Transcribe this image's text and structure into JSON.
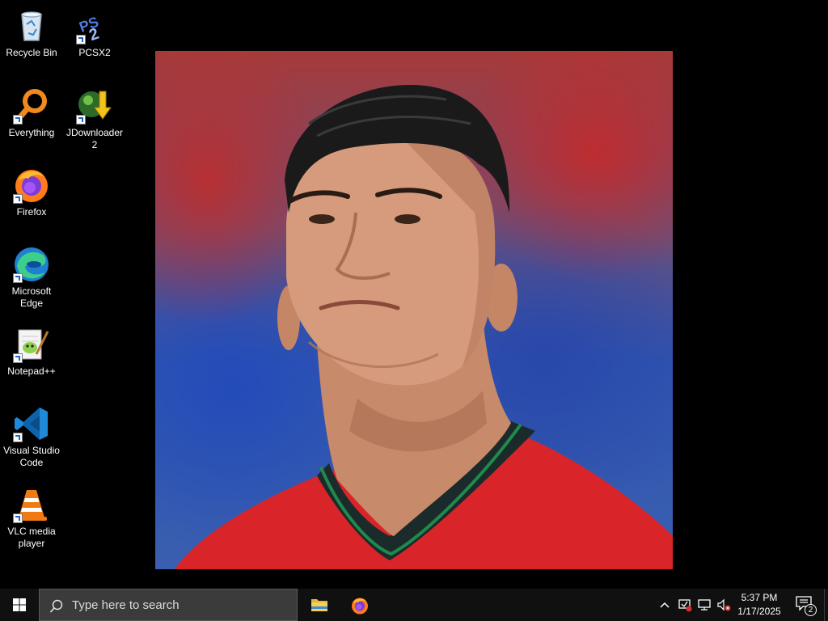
{
  "desktop": {
    "icons": [
      {
        "label": "Recycle Bin",
        "icon": "recycle-bin-icon"
      },
      {
        "label": "PCSX2",
        "icon": "pcsx2-icon"
      },
      {
        "label": "Everything",
        "icon": "everything-search-icon"
      },
      {
        "label": "JDownloader 2",
        "icon": "jdownloader-icon"
      },
      {
        "label": "Firefox",
        "icon": "firefox-icon"
      },
      {
        "label": "Microsoft Edge",
        "icon": "edge-icon"
      },
      {
        "label": "Notepad++",
        "icon": "notepadpp-icon"
      },
      {
        "label": "Visual Studio Code",
        "icon": "vscode-icon"
      },
      {
        "label": "VLC media player",
        "icon": "vlc-icon"
      }
    ],
    "wallpaper": {
      "subject": "portrait photo of a man in a red jersey"
    }
  },
  "taskbar": {
    "search_placeholder": "Type here to search",
    "pinned_apps": [
      {
        "name": "File Explorer",
        "icon": "file-explorer-icon"
      },
      {
        "name": "Firefox",
        "icon": "firefox-icon"
      }
    ],
    "tray": {
      "time": "5:37 PM",
      "date": "1/17/2025",
      "notification_count": "2",
      "icons": [
        "chevron-up-icon",
        "security-alert-icon",
        "network-icon",
        "volume-muted-icon"
      ]
    }
  },
  "colors": {
    "taskbar_bg": "#101010",
    "search_bg": "#3b3b3b",
    "desktop_bg": "#000000",
    "jersey_red": "#d9252a",
    "collar_green": "#1f8a4c"
  }
}
